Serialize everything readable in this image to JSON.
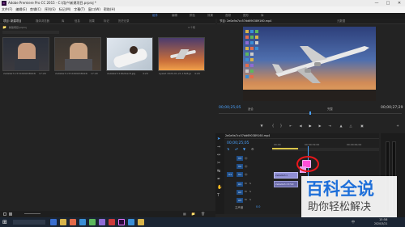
{
  "app": {
    "icon": "Pr",
    "title": "Adobe Premiere Pro CC 2015 - C:\\用户\\新建项目.prproj *"
  },
  "menus": [
    "文件(F)",
    "编辑(E)",
    "剪辑(C)",
    "序列(S)",
    "标记(M)",
    "字幕(T)",
    "窗口(W)",
    "帮助(H)"
  ],
  "workspaces": {
    "items": [
      "组件",
      "编辑",
      "颜色",
      "效果",
      "音频",
      "图形",
      "库"
    ],
    "active_index": 0
  },
  "project_panel": {
    "tabs": [
      "项目: 新建项目",
      "媒体浏览器",
      "库",
      "信息",
      "效果",
      "标记",
      "历史记录"
    ],
    "folder": "新建项目.prproj",
    "count": "4 个项",
    "clips": [
      {
        "name": "2e0a9a7cc57dd690389160.mp4",
        "duration": "17:29"
      },
      {
        "name": "2e0a9a7cc57dd690389160.mp4",
        "duration": "17:29"
      },
      {
        "name": "2e0a9a7c16bd4ac8.jpg",
        "duration": "4:29"
      },
      {
        "name": "Ayelet 2020-01-21-1528.jpg",
        "duration": "4:29"
      }
    ]
  },
  "program_monitor": {
    "tabs": [
      "节目: 2e0a9a7cc57dd690389160.mp4",
      "元数据"
    ],
    "timecode_left": "00;00;25;05",
    "timecode_right": "00;00;27;29",
    "fit": "适合",
    "quality": "完整"
  },
  "timeline": {
    "tab": "2e0a9a7cc57dd690389160.mp4",
    "timecode": "00;00;25;05",
    "ruler_labels": [
      "00;00",
      "00;00;32;00",
      "00;00;64;00"
    ],
    "video_tracks": [
      "V3",
      "V2",
      "V1"
    ],
    "audio_tracks": [
      "A1",
      "A2",
      "A3"
    ],
    "master": "主声道",
    "master_value": "0.0",
    "clip_v2": "2e0a9a7cc",
    "clip_v1": "2e0a9a7cc57dd"
  },
  "watermark": {
    "line1": "百科全说",
    "line2": "助你轻松解决"
  },
  "taskbar": {
    "time": "15:58",
    "date": "2020/3/21",
    "lang": "中"
  },
  "colors": {
    "accent": "#4aa3ff",
    "premiere_purple": "#ea77ff",
    "marker_pink": "#ff4fd8",
    "annotation_red": "#e8161b",
    "watermark_blue": "#1e6fd9"
  }
}
